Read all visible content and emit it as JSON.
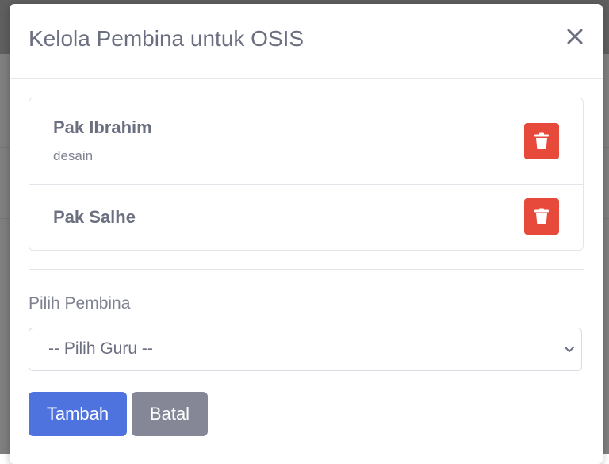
{
  "modal": {
    "title": "Kelola Pembina untuk OSIS",
    "close_icon": "close-icon"
  },
  "pembina_list": [
    {
      "name": "Pak Ibrahim",
      "role": "desain",
      "delete_icon": "trash-icon"
    },
    {
      "name": "Pak Salhe",
      "delete_icon": "trash-icon"
    }
  ],
  "form": {
    "label": "Pilih Pembina",
    "select_value": "-- Pilih Guru --"
  },
  "buttons": {
    "add_label": "Tambah",
    "cancel_label": "Batal"
  },
  "colors": {
    "primary": "#4e73df",
    "secondary": "#858796",
    "danger": "#e74a3b"
  }
}
